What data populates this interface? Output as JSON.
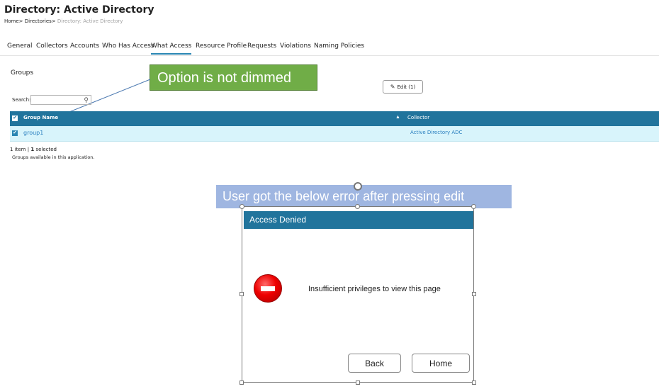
{
  "header": {
    "title": "Directory: Active Directory",
    "breadcrumb": {
      "home": "Home",
      "sep1": ">",
      "directories": "Directories",
      "sep2": ">",
      "current": "Directory: Active Directory"
    }
  },
  "tabs": [
    {
      "label": "General"
    },
    {
      "label": "Collectors"
    },
    {
      "label": "Accounts"
    },
    {
      "label": "Who Has Access"
    },
    {
      "label": "What Access",
      "active": true
    },
    {
      "label": "Resource Profile"
    },
    {
      "label": "Requests"
    },
    {
      "label": "Violations"
    },
    {
      "label": "Naming Policies"
    }
  ],
  "groups": {
    "heading": "Groups",
    "edit_label": "Edit (1)",
    "search_label": "Search:",
    "search_value": "",
    "columns": [
      "Group Name",
      "Collector"
    ],
    "rows": [
      {
        "name": "group1",
        "collector": "Active Directory ADC",
        "checked": true
      }
    ],
    "count_items": "1 item",
    "count_sep": "|",
    "count_selected_num": "1",
    "count_selected_word": "selected",
    "note": "Groups available in this application."
  },
  "annotations": {
    "callout": "Option is not dimmed",
    "caption": "User got the below error after pressing edit"
  },
  "dialog": {
    "title": "Access Denied",
    "message": "Insufficient privileges to view this page",
    "back_label": "Back",
    "home_label": "Home",
    "icon": "stop-icon"
  },
  "colors": {
    "accent": "#21749c",
    "row_highlight": "#d8f4fb",
    "callout_bg": "#70ad47",
    "caption_bg": "#8faadc",
    "stop_red": "#e00000"
  }
}
